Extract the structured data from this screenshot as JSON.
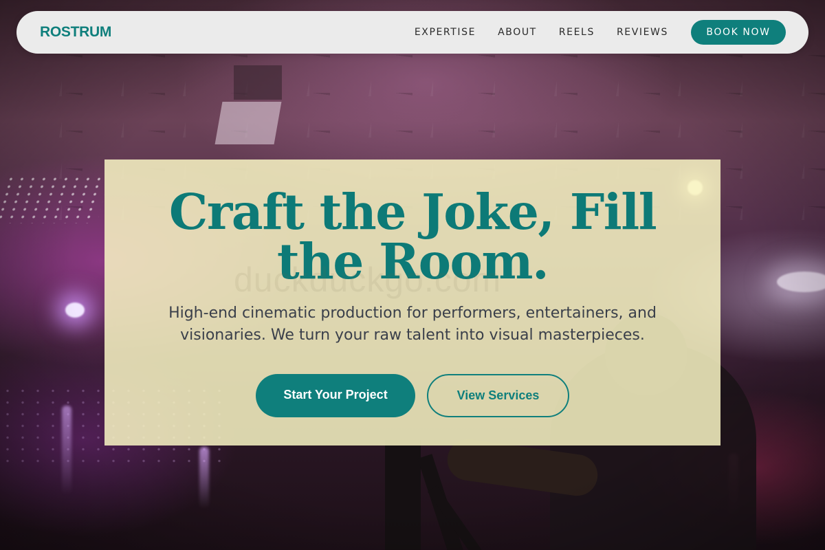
{
  "nav": {
    "brand": "ROSTRUM",
    "links": [
      {
        "label": "EXPERTISE"
      },
      {
        "label": "ABOUT"
      },
      {
        "label": "REELS"
      },
      {
        "label": "REVIEWS"
      }
    ],
    "cta_label": "BOOK NOW"
  },
  "hero": {
    "title": "Craft the Joke, Fill the Room.",
    "subtitle": "High-end cinematic production for performers, entertainers, and visionaries. We turn your raw talent into visual masterpieces.",
    "primary_button": "Start Your Project",
    "secondary_button": "View Services",
    "watermark": "duckduckgo.com"
  },
  "colors": {
    "brand_teal": "#0f7f7c",
    "navbar_bg": "#ebebeb",
    "card_bg": "#f8f4c4",
    "subtitle_text": "#3a3f4a"
  }
}
